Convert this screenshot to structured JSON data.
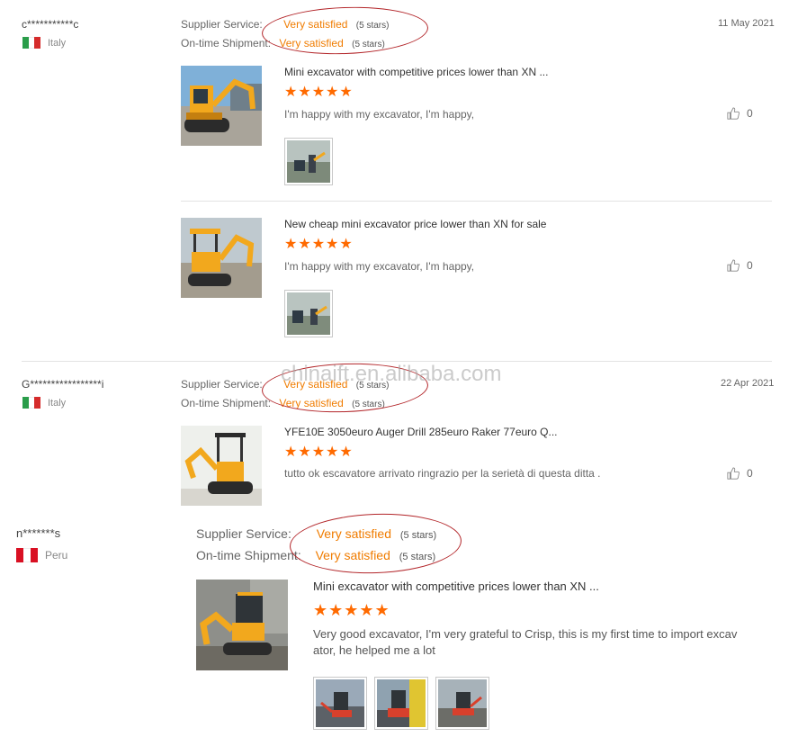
{
  "watermark": "chinaift.en.alibaba.com",
  "reviews": [
    {
      "reviewer": "c***********c",
      "country": "Italy",
      "date": "11 May 2021",
      "supplier_label": "Supplier Service:",
      "supplier_value": "Very satisfied",
      "supplier_stars": "(5 stars)",
      "shipment_label": "On-time Shipment:",
      "shipment_value": "Very satisfied",
      "shipment_stars": "(5 stars)",
      "items": [
        {
          "title": "Mini excavator with competitive prices lower than XN ...",
          "stars": "★★★★★",
          "comment": "I'm happy with my excavator, I'm happy,",
          "likes": "0"
        },
        {
          "title": "New cheap mini excavator price lower than XN for sale",
          "stars": "★★★★★",
          "comment": "I'm happy with my excavator, I'm happy,",
          "likes": "0"
        }
      ]
    },
    {
      "reviewer": "G*****************i",
      "country": "Italy",
      "date": "22 Apr 2021",
      "supplier_label": "Supplier Service:",
      "supplier_value": "Very satisfied",
      "supplier_stars": "(5 stars)",
      "shipment_label": "On-time Shipment:",
      "shipment_value": "Very satisfied",
      "shipment_stars": "(5 stars)",
      "items": [
        {
          "title": "YFE10E 3050euro Auger Drill 285euro Raker 77euro Q...",
          "stars": "★★★★★",
          "comment": "tutto ok escavatore arrivato ringrazio per la serietà di questa ditta .",
          "likes": "0"
        }
      ]
    },
    {
      "reviewer": "n*******s",
      "country": "Peru",
      "supplier_label": "Supplier Service:",
      "supplier_value": "Very satisfied",
      "supplier_stars": "(5 stars)",
      "shipment_label": "On-time Shipment:",
      "shipment_value": "Very satisfied",
      "shipment_stars": "(5 stars)",
      "items": [
        {
          "title": "Mini excavator with competitive prices lower than XN ...",
          "stars": "★★★★★",
          "comment_line1": "Very good excavator, I'm very grateful to Crisp, this is my first time to import excav",
          "comment_line2": "ator, he helped me a lot"
        }
      ]
    }
  ],
  "colors": {
    "accent": "#f07c00",
    "stars": "#ff6a00",
    "circle": "#b3262a",
    "excavator_yellow": "#f2a81d"
  }
}
